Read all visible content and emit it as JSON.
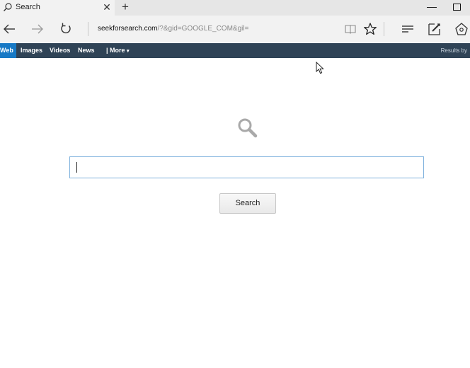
{
  "browser": {
    "tab_title": "Search",
    "new_tab_glyph": "+",
    "close_glyph": "✕",
    "minimize_glyph": "—",
    "url_domain": "seekforsearch.com",
    "url_rest": "/?&gid=GOOGLE_COM&gil="
  },
  "search_nav": {
    "items": [
      "Web",
      "Images",
      "Videos",
      "News",
      "| More"
    ],
    "more_arrow": "▾",
    "results_by": "Results by"
  },
  "main": {
    "search_input_value": "",
    "search_button_label": "Search"
  },
  "colors": {
    "nav_bar": "#2f4356",
    "active_tab": "#1779c5",
    "input_border": "#7fb2dd"
  },
  "icons": [
    "magnifier-icon",
    "back-arrow-icon",
    "forward-arrow-icon",
    "refresh-icon",
    "reading-view-icon",
    "favorite-star-icon",
    "hub-icon",
    "web-note-icon",
    "share-icon",
    "mouse-pointer-icon"
  ]
}
